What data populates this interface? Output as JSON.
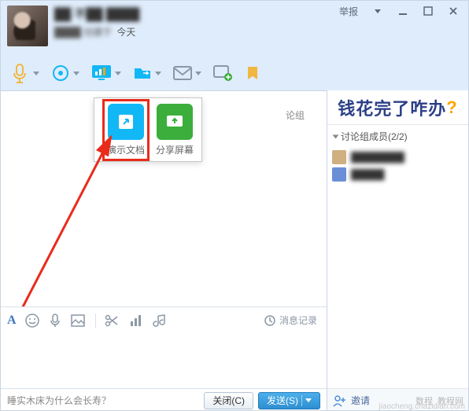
{
  "header": {
    "title_blurred": "██ 不██ ████",
    "subtitle_blurred": "████ 创建于",
    "subtitle_clear": "今天",
    "report_label": "举报"
  },
  "toolbar": {
    "icons": [
      "voice-icon",
      "video-icon",
      "screen-share-icon",
      "send-file-icon",
      "mail-icon",
      "add-app-icon",
      "favorite-icon"
    ]
  },
  "chat": {
    "banner_text": "论组",
    "popup": {
      "item1_label": "演示文档",
      "item2_label": "分享屏幕"
    }
  },
  "editbar": {
    "font_label": "A",
    "history_label": "消息记录"
  },
  "bottom": {
    "hint": "睡实木床为什么会长寿？",
    "close_label": "关闭(C)",
    "send_label": "发送(S)"
  },
  "right": {
    "promo_text": "钱花完了咋办",
    "promo_q": "?",
    "members_header": "讨论组成员(2/2)",
    "members": [
      {
        "name_blurred": "████████"
      },
      {
        "name_blurred": "█████"
      }
    ],
    "invite_label": "邀请",
    "watermark_a": "数程",
    "watermark_b": "教程网",
    "source": "jiaocheng.chazidian.com"
  }
}
